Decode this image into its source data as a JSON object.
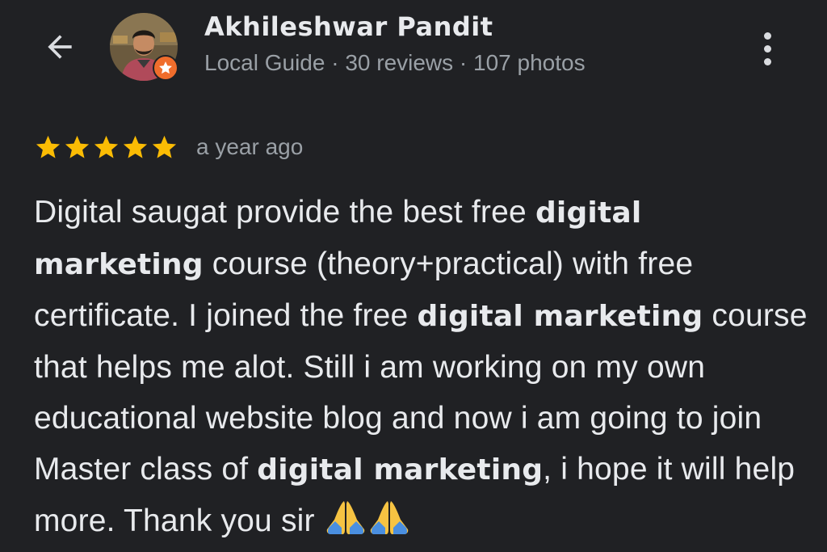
{
  "header": {
    "back_icon": "arrow-left-icon",
    "reviewer": {
      "name": "Akhileshwar Pandit",
      "meta": "Local Guide · 30 reviews · 107 photos",
      "badge_icon": "local-guide-star-icon"
    },
    "menu_icon": "more-vert-icon"
  },
  "review": {
    "rating": 5,
    "rating_max": 5,
    "time": "a year ago",
    "segments": [
      {
        "text": "Digital saugat provide the best free ",
        "bold": false
      },
      {
        "text": "digital marketing",
        "bold": true
      },
      {
        "text": " course (theory+practical) with free certificate. I joined the free ",
        "bold": false
      },
      {
        "text": "digital marketing",
        "bold": true
      },
      {
        "text": " course that helps me alot. Still i am working on my own educational website blog and now i am going to join Master class of ",
        "bold": false
      },
      {
        "text": "digital marketing",
        "bold": true
      },
      {
        "text": ", i hope it will help more. Thank you sir ",
        "bold": false
      }
    ],
    "trailing_emoji": [
      "folded-hands-emoji",
      "folded-hands-emoji"
    ]
  },
  "colors": {
    "background": "#202124",
    "text_primary": "#e8eaed",
    "text_secondary": "#9aa0a6",
    "star": "#fbbc04",
    "badge": "#f06d2c"
  }
}
